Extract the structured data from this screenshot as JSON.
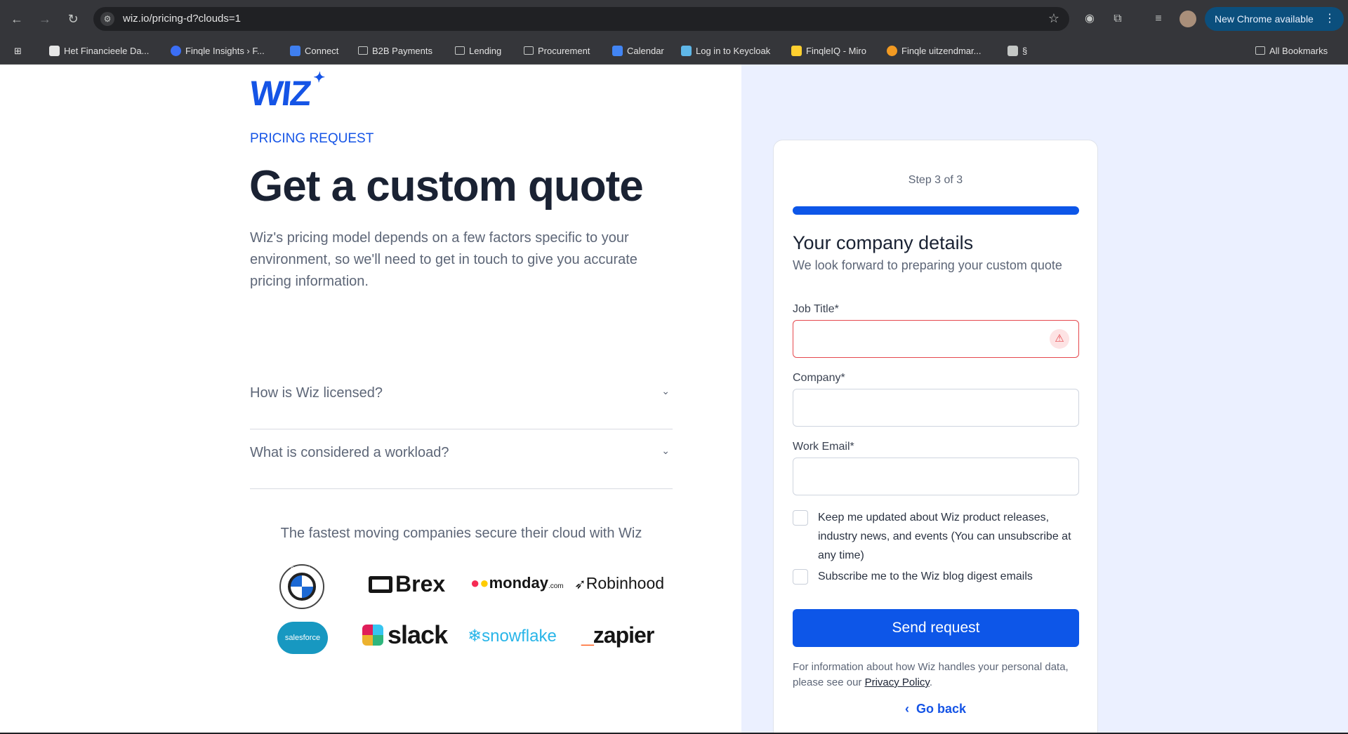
{
  "browser": {
    "url": "wiz.io/pricing-d?clouds=1",
    "update_label": "New Chrome available",
    "bookmarks": [
      {
        "label": "Het Financieele Da..."
      },
      {
        "label": "Finqle Insights › F..."
      },
      {
        "label": "Connect"
      },
      {
        "label": "B2B Payments"
      },
      {
        "label": "Lending"
      },
      {
        "label": "Procurement"
      },
      {
        "label": "Calendar"
      },
      {
        "label": "Log in to Keycloak"
      },
      {
        "label": "FinqleIQ - Miro"
      },
      {
        "label": "Finqle uitzendmar..."
      },
      {
        "label": "§"
      }
    ],
    "all_bookmarks": "All Bookmarks"
  },
  "left": {
    "logo": "WIZ",
    "eyebrow": "PRICING REQUEST",
    "title": "Get a custom quote",
    "lead": "Wiz's pricing model depends on a few factors specific to your environment, so we'll need to get in touch to give you accurate pricing information.",
    "faqs": [
      {
        "question": "How is Wiz licensed?"
      },
      {
        "question": "What is considered a workload?"
      }
    ],
    "trust_heading": "The fastest moving companies secure their cloud with Wiz",
    "logos": {
      "bmw": "BMW",
      "brex": "Brex",
      "monday": "monday",
      "monday_suffix": ".com",
      "robinhood": "Robinhood",
      "salesforce": "salesforce",
      "slack": "slack",
      "snowflake": "snowflake",
      "zapier": "zapier"
    }
  },
  "form": {
    "step": "Step 3 of 3",
    "progress": 1.0,
    "title": "Your company details",
    "subtitle": "We look forward to preparing your custom quote",
    "job_title_label": "Job Title*",
    "job_title_value": "",
    "company_label": "Company*",
    "company_value": "",
    "email_label": "Work Email*",
    "email_value": "",
    "consent_updates": "Keep me updated about Wiz product releases, industry news, and events (You can unsubscribe at any time)",
    "consent_blog": "Subscribe me to the Wiz blog digest emails",
    "submit": "Send request",
    "privacy_prefix": "For information about how Wiz handles your personal data, please see our ",
    "privacy_link": "Privacy Policy",
    "privacy_suffix": ".",
    "go_back": "Go back"
  },
  "colors": {
    "brand": "#1554e6",
    "error": "#e5484d",
    "panel": "#ebf0ff"
  }
}
